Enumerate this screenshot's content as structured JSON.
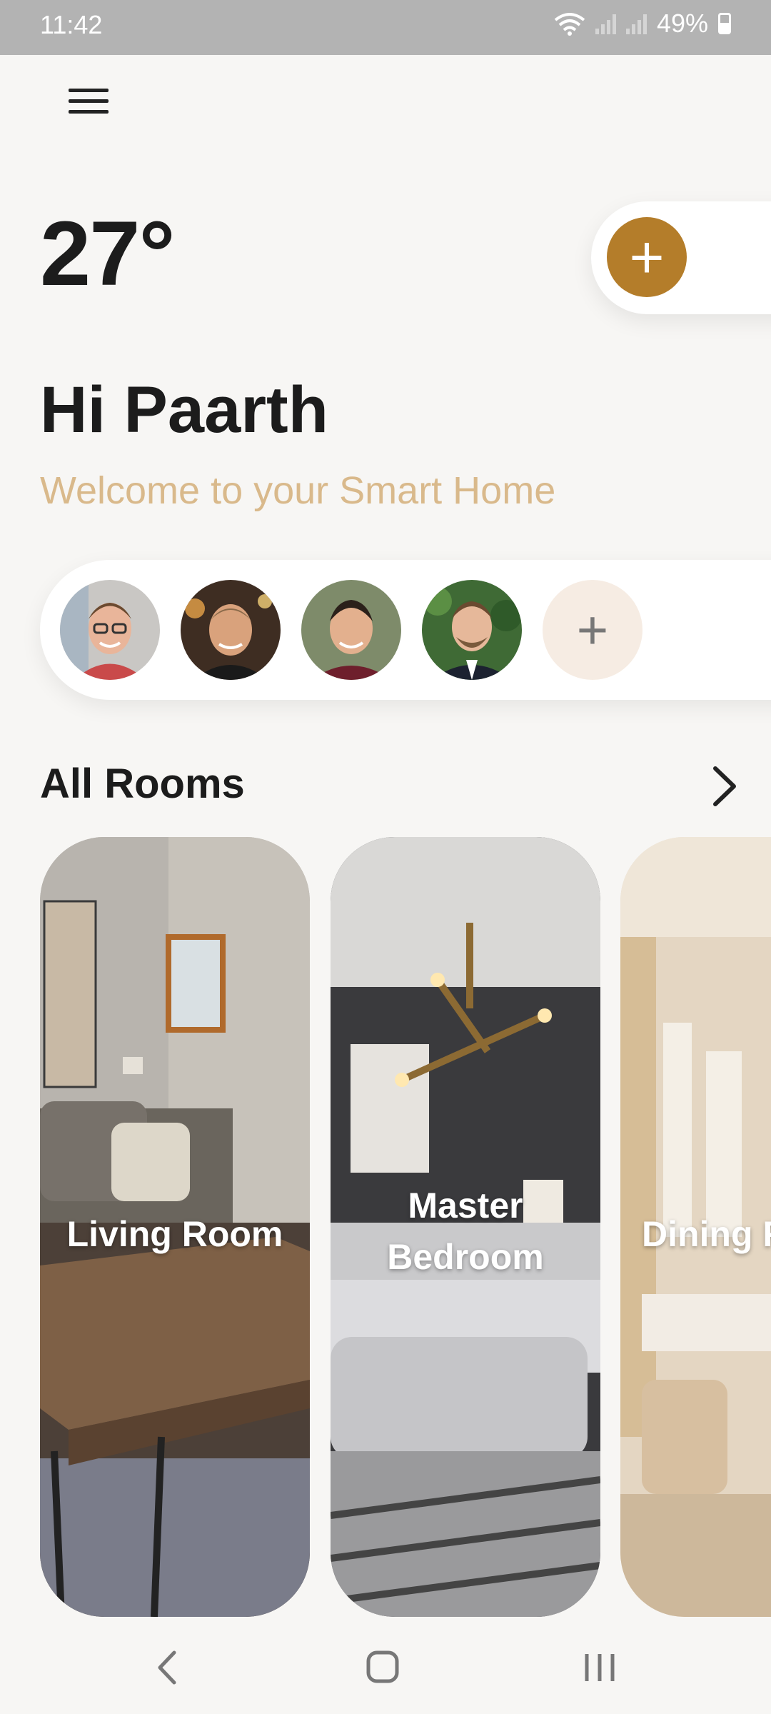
{
  "status_bar": {
    "time": "11:42",
    "battery": "49%"
  },
  "weather": {
    "temperature": "27°"
  },
  "greeting": {
    "title": "Hi Paarth",
    "subtitle": "Welcome to your Smart Home"
  },
  "members": {
    "avatars": [
      "member-1",
      "member-2",
      "member-3",
      "member-4"
    ],
    "add_icon": "+"
  },
  "add_button": {
    "icon": "+"
  },
  "rooms": {
    "section_title": "All Rooms",
    "items": [
      {
        "label": "Living Room"
      },
      {
        "label_line1": "Master",
        "label_line2": "Bedroom"
      },
      {
        "label": "Dining Room"
      }
    ]
  },
  "colors": {
    "accent": "#b47d2a",
    "welcome": "#d9b98b",
    "background": "#f7f6f4"
  }
}
